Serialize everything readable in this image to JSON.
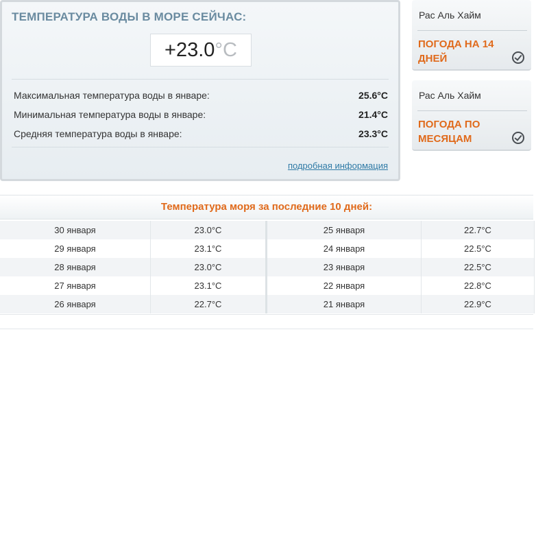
{
  "main": {
    "title": "ТЕМПЕРАТУРА ВОДЫ В МОРЕ СЕЙЧАС:",
    "current_value": "+23.0",
    "current_unit": "°C",
    "stats": [
      {
        "label": "Максимальная температура воды в январе:",
        "value": "25.6°C"
      },
      {
        "label": "Минимальная температура воды в январе:",
        "value": "21.4°C"
      },
      {
        "label": "Средняя температура воды в январе:",
        "value": "23.3°C"
      }
    ],
    "more_link": "подробная информация"
  },
  "side_cards": [
    {
      "city": "Рас Аль Хайм",
      "cta": "ПОГОДА НА 14 ДНЕЙ"
    },
    {
      "city": "Рас Аль Хайм",
      "cta": "ПОГОДА ПО МЕСЯЦАМ"
    }
  ],
  "history": {
    "title": "Температура моря за последние 10 дней:",
    "rows": [
      {
        "d1": "30 января",
        "t1": "23.0°C",
        "d2": "25 января",
        "t2": "22.7°C"
      },
      {
        "d1": "29 января",
        "t1": "23.1°C",
        "d2": "24 января",
        "t2": "22.5°C"
      },
      {
        "d1": "28 января",
        "t1": "23.0°C",
        "d2": "23 января",
        "t2": "22.5°C"
      },
      {
        "d1": "27 января",
        "t1": "23.1°C",
        "d2": "22 января",
        "t2": "22.8°C"
      },
      {
        "d1": "26 января",
        "t1": "22.7°C",
        "d2": "21 января",
        "t2": "22.9°C"
      }
    ]
  },
  "colors": {
    "title_blue": "#6a8ba0",
    "accent_orange": "#e06a1b",
    "link_blue": "#2e7aa6"
  }
}
